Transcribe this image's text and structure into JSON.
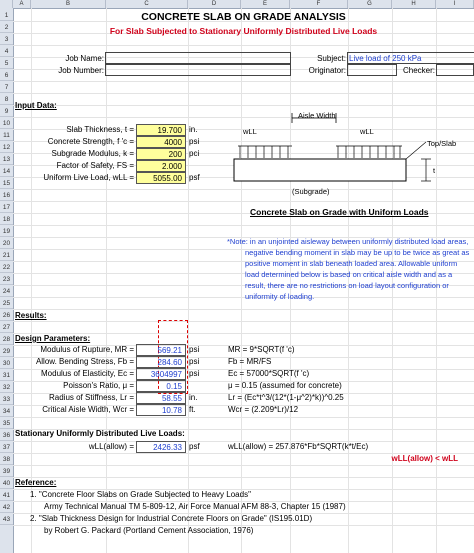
{
  "column_headers": [
    "A",
    "B",
    "C",
    "D",
    "E",
    "F",
    "G",
    "H",
    "I"
  ],
  "row_numbers": [
    "1",
    "2",
    "3",
    "4",
    "5",
    "6",
    "7",
    "8",
    "9",
    "10",
    "11",
    "12",
    "13",
    "14",
    "15",
    "16",
    "17",
    "18",
    "19",
    "20",
    "21",
    "22",
    "23",
    "24",
    "25",
    "26",
    "27",
    "28",
    "29",
    "30",
    "31",
    "32",
    "33",
    "34",
    "35",
    "36",
    "37",
    "38",
    "39",
    "40",
    "41",
    "42",
    "43"
  ],
  "title": "CONCRETE SLAB ON GRADE ANALYSIS",
  "subtitle": "For Slab Subjected to Stationary Uniformly Distributed Live Loads",
  "header": {
    "job_name_label": "Job Name:",
    "job_number_label": "Job Number:",
    "subject_label": "Subject:",
    "subject_value": "Live load of 250 kPa",
    "originator_label": "Originator:",
    "checker_label": "Checker:"
  },
  "input": {
    "heading": "Input Data:",
    "rows": [
      {
        "label": "Slab Thickness, t =",
        "value": "19.700",
        "unit": "in."
      },
      {
        "label": "Concrete Strength, f 'c =",
        "value": "4000",
        "unit": "psi"
      },
      {
        "label": "Subgrade Modulus, k =",
        "value": "200",
        "unit": "pci"
      },
      {
        "label": "Factor of Safety, FS =",
        "value": "2.000",
        "unit": ""
      },
      {
        "label": "Uniform Live Load, wLL =",
        "value": "5055.00",
        "unit": "psf"
      }
    ]
  },
  "diagram": {
    "aisle_width": "Aisle Width",
    "wll_left": "wLL",
    "wll_right": "wLL",
    "top_slab": "Top/Slab",
    "t_label": "t",
    "subgrade": "(Subgrade)",
    "caption": "Concrete Slab on Grade with Uniform Loads"
  },
  "note": {
    "lines": [
      "*Note: in an unjointed aisleway between uniformly distributed load areas,",
      "negative bending moment in slab may be up to be twice as great as",
      "positive moment in slab beneath loaded area. Allowable uniform",
      "load determined below is based on critical aisle width and as a",
      "result, there are no restrictions on load layout configuration or",
      "uniformity of loading."
    ]
  },
  "results": {
    "heading": "Results:",
    "design_heading": "Design Parameters:",
    "rows": [
      {
        "label": "Modulus of Rupture, MR =",
        "value": "569.21",
        "unit": "psi",
        "formula": "MR = 9*SQRT(f 'c)"
      },
      {
        "label": "Allow. Bending Stress, Fb =",
        "value": "284.60",
        "unit": "psi",
        "formula": "Fb = MR/FS"
      },
      {
        "label": "Modulus of Elasticity, Ec =",
        "value": "3604997",
        "unit": "psi",
        "formula": "Ec = 57000*SQRT(f 'c)"
      },
      {
        "label": "Poisson's Ratio, μ =",
        "value": "0.15",
        "unit": "",
        "formula": "μ = 0.15 (assumed for concrete)"
      },
      {
        "label": "Radius of Stiffness, Lr =",
        "value": "58.55",
        "unit": "in.",
        "formula": "Lr = (Ec*t^3/(12*(1-μ^2)*k))^0.25"
      },
      {
        "label": "Critical Aisle Width, Wcr =",
        "value": "10.78",
        "unit": "ft.",
        "formula": "Wcr = (2.209*Lr)/12"
      }
    ],
    "live_heading": "Stationary Uniformly Distributed Live Loads:",
    "wll_label": "wLL(allow) =",
    "wll_value": "2426.33",
    "wll_unit": "psf",
    "wll_formula": "wLL(allow) = 257.876*Fb*SQRT(k*t/Ec)",
    "check": "wLL(allow) < wLL"
  },
  "references": {
    "heading": "Reference:",
    "lines": [
      "1. \"Concrete Floor Slabs on Grade Subjected to Heavy Loads\"",
      "Army Technical Manual TM 5-809-12, Air Force Manual AFM 88-3, Chapter 15 (1987)",
      "2. \"Slab Thickness Design for Industrial Concrete Floors on Grade\" (IS195.01D)",
      "by Robert G. Packard (Portland Cement Association, 1976)"
    ]
  }
}
